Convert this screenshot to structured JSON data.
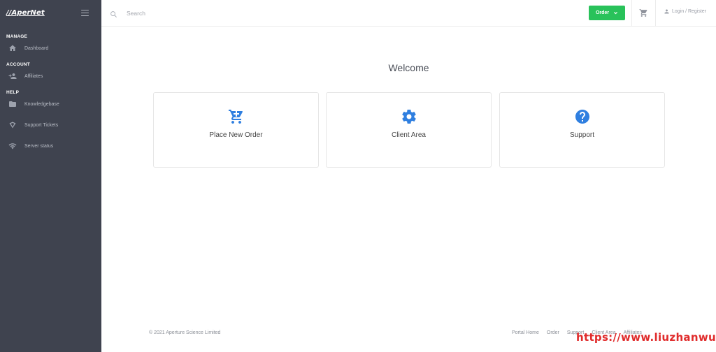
{
  "brand": {
    "logo": "//AperNet"
  },
  "sidebar": {
    "sections": [
      {
        "label": "MANAGE",
        "items": [
          {
            "label": "Dashboard",
            "icon": "home-icon"
          }
        ]
      },
      {
        "label": "ACCOUNT",
        "items": [
          {
            "label": "Affiliates",
            "icon": "users-icon"
          }
        ]
      },
      {
        "label": "HELP",
        "items": [
          {
            "label": "Knowledgebase",
            "icon": "folder-icon"
          },
          {
            "label": "Support Tickets",
            "icon": "ticket-icon"
          },
          {
            "label": "Server status",
            "icon": "wifi-icon"
          }
        ]
      }
    ]
  },
  "topbar": {
    "search_placeholder": "Search",
    "order_label": "Order",
    "login_label": "Login / Register"
  },
  "main": {
    "heading": "Welcome",
    "cards": [
      {
        "title": "Place New Order",
        "icon": "cart-icon"
      },
      {
        "title": "Client Area",
        "icon": "gear-icon"
      },
      {
        "title": "Support",
        "icon": "question-icon"
      }
    ]
  },
  "footer": {
    "copyright": "© 2021 Aperture Science Limited",
    "links": [
      "Portal Home",
      "Order",
      "Support",
      "Client Area",
      "Affiliates"
    ]
  },
  "watermark": "https://www.liuzhanwu.cn",
  "colors": {
    "sidebar": "#3f434f",
    "accent_green": "#29c25a",
    "icon_blue": "#2f7fe0",
    "watermark_red": "#e02b2b"
  }
}
